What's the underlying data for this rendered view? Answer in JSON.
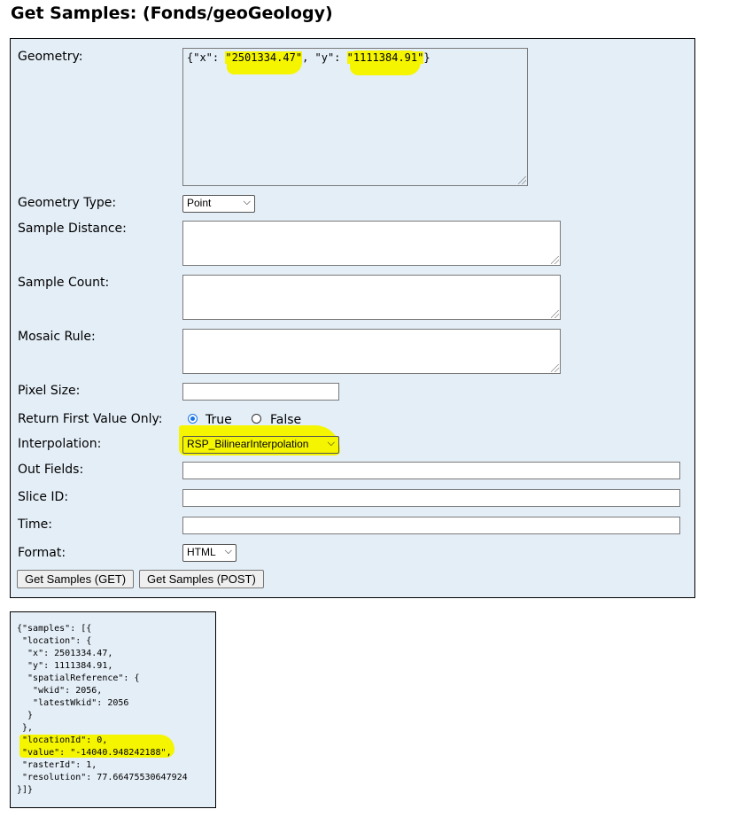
{
  "page": {
    "title": "Get Samples: (Fonds/geoGeology)"
  },
  "form": {
    "geometry": {
      "label": "Geometry:",
      "parts": [
        "{\"x\": ",
        "\"2501334.47\"",
        ", \"y\": ",
        "\"1111384.91\"",
        "}"
      ]
    },
    "geometry_type": {
      "label": "Geometry Type:",
      "value": "Point"
    },
    "sample_distance": {
      "label": "Sample Distance:",
      "value": ""
    },
    "sample_count": {
      "label": "Sample Count:",
      "value": ""
    },
    "mosaic_rule": {
      "label": "Mosaic Rule:",
      "value": ""
    },
    "pixel_size": {
      "label": "Pixel Size:",
      "value": ""
    },
    "return_first_value_only": {
      "label": "Return First Value Only:",
      "options": [
        {
          "label": "True",
          "checked": true
        },
        {
          "label": "False",
          "checked": false
        }
      ]
    },
    "interpolation": {
      "label": "Interpolation:",
      "value": "RSP_BilinearInterpolation"
    },
    "out_fields": {
      "label": "Out Fields:",
      "value": ""
    },
    "slice_id": {
      "label": "Slice ID:",
      "value": ""
    },
    "time": {
      "label": "Time:",
      "value": ""
    },
    "format": {
      "label": "Format:",
      "value": "HTML"
    },
    "buttons": {
      "get": "Get Samples (GET)",
      "post": "Get Samples (POST)"
    }
  },
  "result": {
    "line_01": "{\"samples\": [{",
    "line_02": " \"location\": {",
    "line_03": "  \"x\": 2501334.47,",
    "line_04": "  \"y\": 1111384.91,",
    "line_05": "  \"spatialReference\": {",
    "line_06": "   \"wkid\": 2056,",
    "line_07": "   \"latestWkid\": 2056",
    "line_08": "  }",
    "line_09": " },",
    "line_10": " \"locationId\": 0,",
    "line_11": " \"value\": \"-14040.948242188\",",
    "line_12": " \"rasterId\": 1,",
    "line_13": " \"resolution\": 77.66475530647924",
    "line_14": "}]}"
  },
  "colors": {
    "panel": "#e4eef7",
    "highlight": "#f5f500",
    "radio_checked": "#1a73e8"
  },
  "icons": {
    "select_arrow": "chevron-down-icon"
  }
}
